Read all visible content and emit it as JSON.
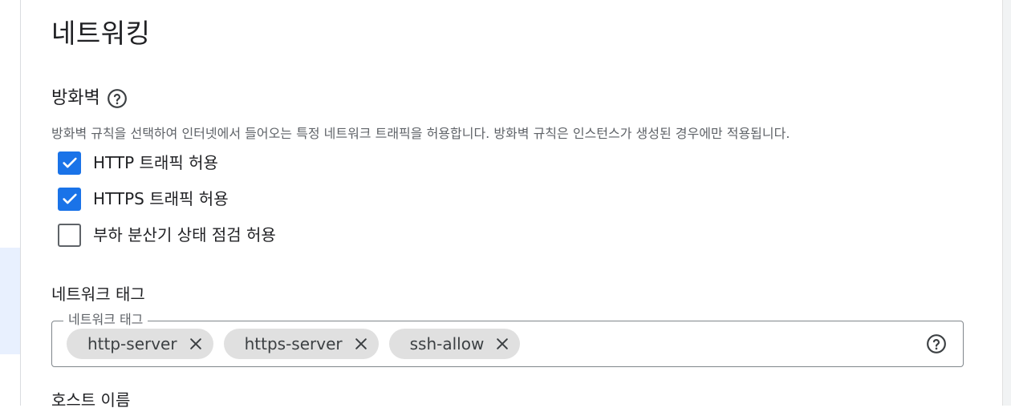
{
  "section": {
    "title": "네트워킹"
  },
  "firewall": {
    "heading": "방화벽",
    "description": "방화벽 규칙을 선택하여 인터넷에서 들어오는 특정 네트워크 트래픽을 허용합니다. 방화벽 규칙은 인스턴스가 생성된 경우에만 적용됩니다.",
    "options": [
      {
        "label": "HTTP 트래픽 허용",
        "checked": true
      },
      {
        "label": "HTTPS 트래픽 허용",
        "checked": true
      },
      {
        "label": "부하 분산기 상태 점검 허용",
        "checked": false
      }
    ]
  },
  "network_tags": {
    "heading": "네트워크 태그",
    "field_label": "네트워크 태그",
    "tags": [
      "http-server",
      "https-server",
      "ssh-allow"
    ]
  },
  "hostname": {
    "heading": "호스트 이름"
  },
  "colors": {
    "accent": "#1a73e8",
    "chip_bg": "#e0e0e0",
    "text": "#202124",
    "secondary_text": "#5f6368"
  }
}
